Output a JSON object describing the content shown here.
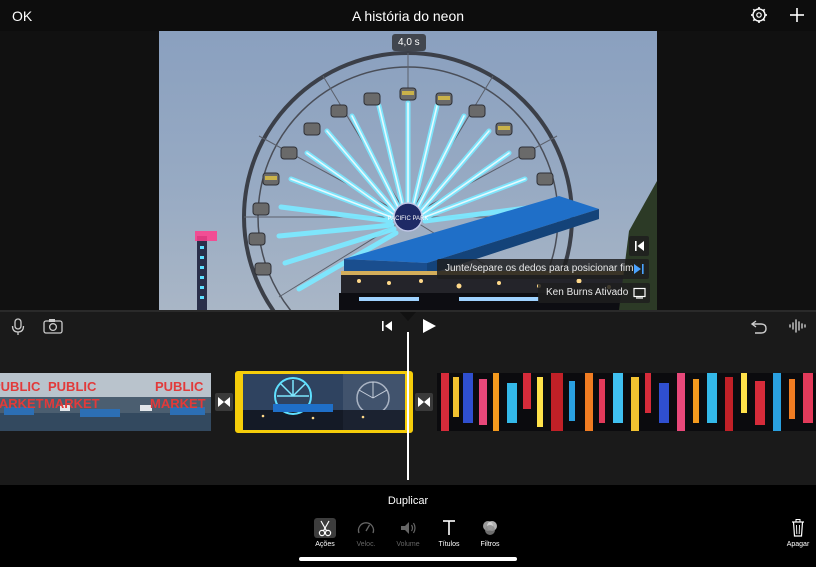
{
  "header": {
    "ok_label": "OK",
    "title": "A história do neon"
  },
  "viewer": {
    "duration": "4,0 s",
    "ken_burns_tip": "Junte/separe os dedos para posicionar fim",
    "ken_burns_status": "Ken Burns Ativado"
  },
  "timeline": {
    "clip_market_text_top": "PUBLIC",
    "clip_market_text_bottom": "MARKET",
    "clip_ferris_sign": "PACIFIC PARK"
  },
  "toolbar": {
    "mode_label": "Duplicar",
    "tools": [
      {
        "label": "Ações"
      },
      {
        "label": "Veloc."
      },
      {
        "label": "Volume"
      },
      {
        "label": "Títulos"
      },
      {
        "label": "Filtros"
      }
    ],
    "delete_label": "Apagar"
  },
  "colors": {
    "selection": "#f5cd0a",
    "accent_blue": "#4aa3ff",
    "background": "#000000"
  }
}
